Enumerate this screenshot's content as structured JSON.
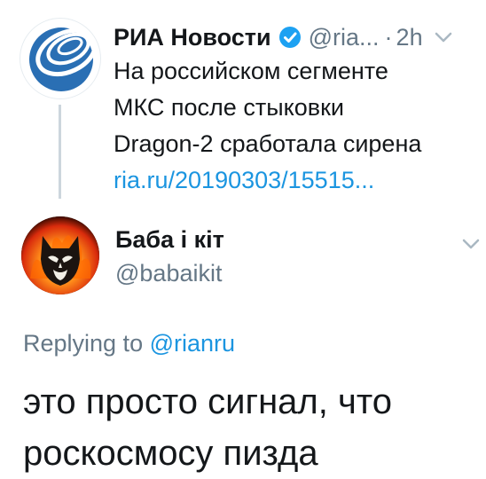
{
  "parent_tweet": {
    "author_name": "РИА Новости",
    "handle": "@ria...",
    "separator": "·",
    "time": "2h",
    "text_lines": [
      "На российском сегменте",
      "МКС после стыковки",
      "Dragon-2 сработала сирена"
    ],
    "link": "ria.ru/20190303/15515...",
    "verified_icon": "verified-badge-icon",
    "menu_icon": "chevron-down-icon"
  },
  "reply": {
    "author_name": "Баба і кіт",
    "handle": "@babaikit",
    "menu_icon": "chevron-down-icon",
    "replying_prefix": "Replying to",
    "replying_handle": "@rianru",
    "text_lines": [
      "это просто сигнал, что",
      "роскосмосу пизда"
    ]
  },
  "colors": {
    "text": "#14171a",
    "secondary": "#657786",
    "link": "#1b95e0",
    "thread_line": "#ccd6dd",
    "verified": "#1da1f2"
  }
}
